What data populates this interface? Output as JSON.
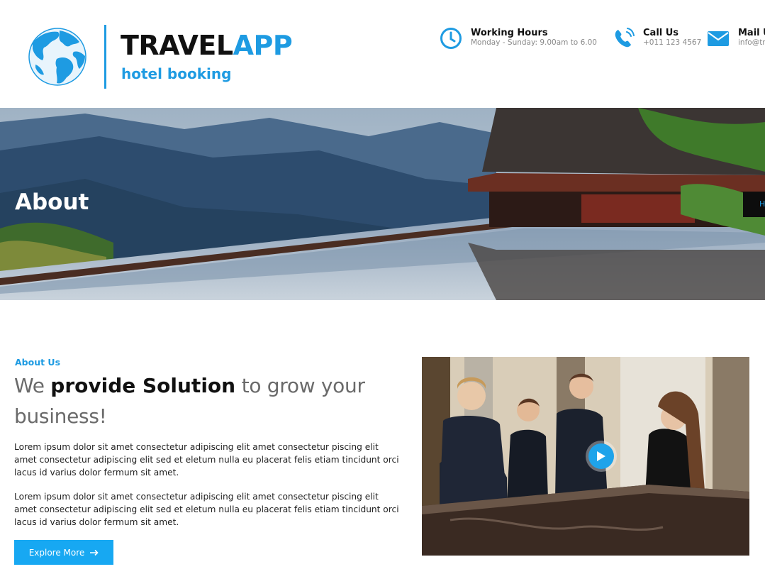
{
  "brand": {
    "name_part1": "TRAVEL",
    "name_part2": "APP",
    "tagline": "hotel booking",
    "accent_color": "#1e9be2",
    "logo_icon": "globe-icon"
  },
  "contact": {
    "hours": {
      "title": "Working Hours",
      "detail": "Monday - Sunday: 9.00am to 6.00",
      "icon": "clock-icon"
    },
    "call": {
      "title": "Call Us",
      "detail": "+011 123 4567",
      "icon": "phone-icon"
    },
    "mail": {
      "title": "Mail Us",
      "detail": "info@travelapp.com",
      "icon": "envelope-icon"
    }
  },
  "hero": {
    "title": "About",
    "breadcrumb": "H"
  },
  "about": {
    "kicker": "About Us",
    "heading_light_1": "We ",
    "heading_bold": "provide Solution",
    "heading_light_2": " to grow your business!",
    "paragraph_1": "Lorem ipsum dolor sit amet consectetur adipiscing elit amet consectetur piscing elit amet consectetur adipiscing elit sed et eletum nulla eu placerat felis etiam tincidunt orci lacus id varius dolor fermum sit amet.",
    "paragraph_2": "Lorem ipsum dolor sit amet consectetur adipiscing elit amet consectetur piscing elit amet consectetur adipiscing elit sed et eletum nulla eu placerat felis etiam tincidunt orci lacus id varius dolor fermum sit amet.",
    "button_label": "Explore More",
    "button_icon": "arrow-right-icon",
    "video_icon": "play-icon"
  }
}
